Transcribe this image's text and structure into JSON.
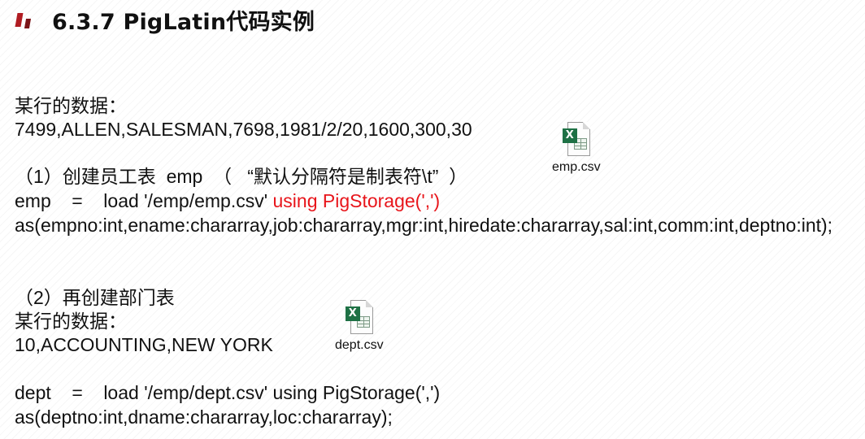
{
  "title": "6.3.7  PigLatin代码实例",
  "emp_section": {
    "data_label": "某行的数据：",
    "data_row": "7499,ALLEN,SALESMAN,7698,1981/2/20,1600,300,30",
    "step_heading": "（1）创建员工表  emp  （   “默认分隔符是制表符\\t”  ）",
    "load_prefix": "emp    =    load '/emp/emp.csv' ",
    "load_using": "using PigStorage(',')",
    "schema": "as(empno:int,ename:chararray,job:chararray,mgr:int,hiredate:chararray,sal:int,comm:int,deptno:int);"
  },
  "dept_section": {
    "step_heading": "（2）再创建部门表",
    "data_label": "某行的数据：",
    "data_row": "10,ACCOUNTING,NEW YORK",
    "load_line": "dept    =    load '/emp/dept.csv' using PigStorage(',')",
    "schema": "as(deptno:int,dname:chararray,loc:chararray);"
  },
  "files": {
    "emp": {
      "name": "emp.csv",
      "icon": "excel-csv-icon"
    },
    "dept": {
      "name": "dept.csv",
      "icon": "excel-csv-icon"
    }
  },
  "colors": {
    "accent_red": "#e8151b",
    "title_mark": "#b01c22"
  }
}
